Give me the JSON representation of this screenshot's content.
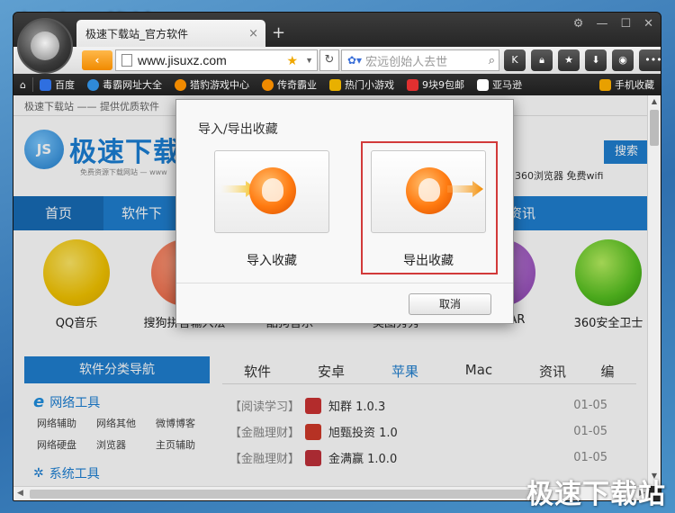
{
  "browser": {
    "tab_title": "极速下载站_官方软件",
    "tab_close": "×",
    "new_tab": "+",
    "url": "www.jisuxz.com",
    "search_placeholder": "宏远创始人去世",
    "window_controls": [
      "shirt-icon",
      "minimize-icon",
      "maximize-icon",
      "close-icon"
    ],
    "toolbar_buttons": [
      "k-icon",
      "lock-icon",
      "star-icon",
      "download-icon",
      "game-icon",
      "menu-icon"
    ]
  },
  "bookmarks": [
    {
      "label": "",
      "icon": "home-icon",
      "color": "#cccccc"
    },
    {
      "label": "百度",
      "icon": "baidu-icon",
      "color": "#2f6fe0"
    },
    {
      "label": "毒霸网址大全",
      "icon": "duba-icon",
      "color": "#2f8ad8"
    },
    {
      "label": "猎豹游戏中心",
      "icon": "liebao-icon",
      "color": "#f08a00"
    },
    {
      "label": "传奇霸业",
      "icon": "game-icon",
      "color": "#f08a00"
    },
    {
      "label": "热门小游戏",
      "icon": "folder-icon",
      "color": "#e8b000"
    },
    {
      "label": "9块9包邮",
      "icon": "tag-icon",
      "color": "#e03030"
    },
    {
      "label": "亚马逊",
      "icon": "amazon-icon",
      "color": "#ffffff"
    }
  ],
  "bookmark_right": "手机收藏",
  "page": {
    "slogan": "极速下载站 —— 提供优质软件",
    "site_badge": "JS",
    "site_name": "极速下载",
    "site_sub": "免费资源下载网站 — www",
    "search_button": "搜索",
    "hotwords": "360浏览器  免费wifi",
    "nav_home": "首页",
    "nav_software": "软件下",
    "nav_info": "资讯",
    "apps": [
      {
        "label": "QQ音乐",
        "color": "#f2c300"
      },
      {
        "label": "搜狗拼音输入法",
        "color": "#e85c3a"
      },
      {
        "label": "酷狗音乐",
        "color": "#cccccc"
      },
      {
        "label": "美图秀秀",
        "color": "#cccccc"
      },
      {
        "label": "WinRAR",
        "color": "#8a3fb0"
      },
      {
        "label": "360安全卫士",
        "color": "#55c020"
      }
    ],
    "category_header": "软件分类导航",
    "category_group1": "网络工具",
    "category_links": [
      "网络辅助",
      "网络其他",
      "微博博客",
      "网络硬盘",
      "浏览器",
      "主页辅助"
    ],
    "category_group2": "系统工具",
    "list_tabs": [
      "软件",
      "安卓",
      "苹果",
      "Mac",
      "资讯",
      "编"
    ],
    "active_tab": "苹果",
    "software_list": [
      {
        "cat": "【阅读学习】",
        "name": "知群 1.0.3",
        "date": "01-05",
        "color": "#cc3333"
      },
      {
        "cat": "【金融理财】",
        "name": "旭甄投资 1.0",
        "date": "01-05",
        "color": "#d03a2a"
      },
      {
        "cat": "【金融理财】",
        "name": "金满赢 1.0.0",
        "date": "01-05",
        "color": "#c0303a"
      }
    ]
  },
  "dialog": {
    "title": "导入/导出收藏",
    "import_label": "导入收藏",
    "export_label": "导出收藏",
    "cancel_label": "取消"
  },
  "watermark": "极速下载站"
}
